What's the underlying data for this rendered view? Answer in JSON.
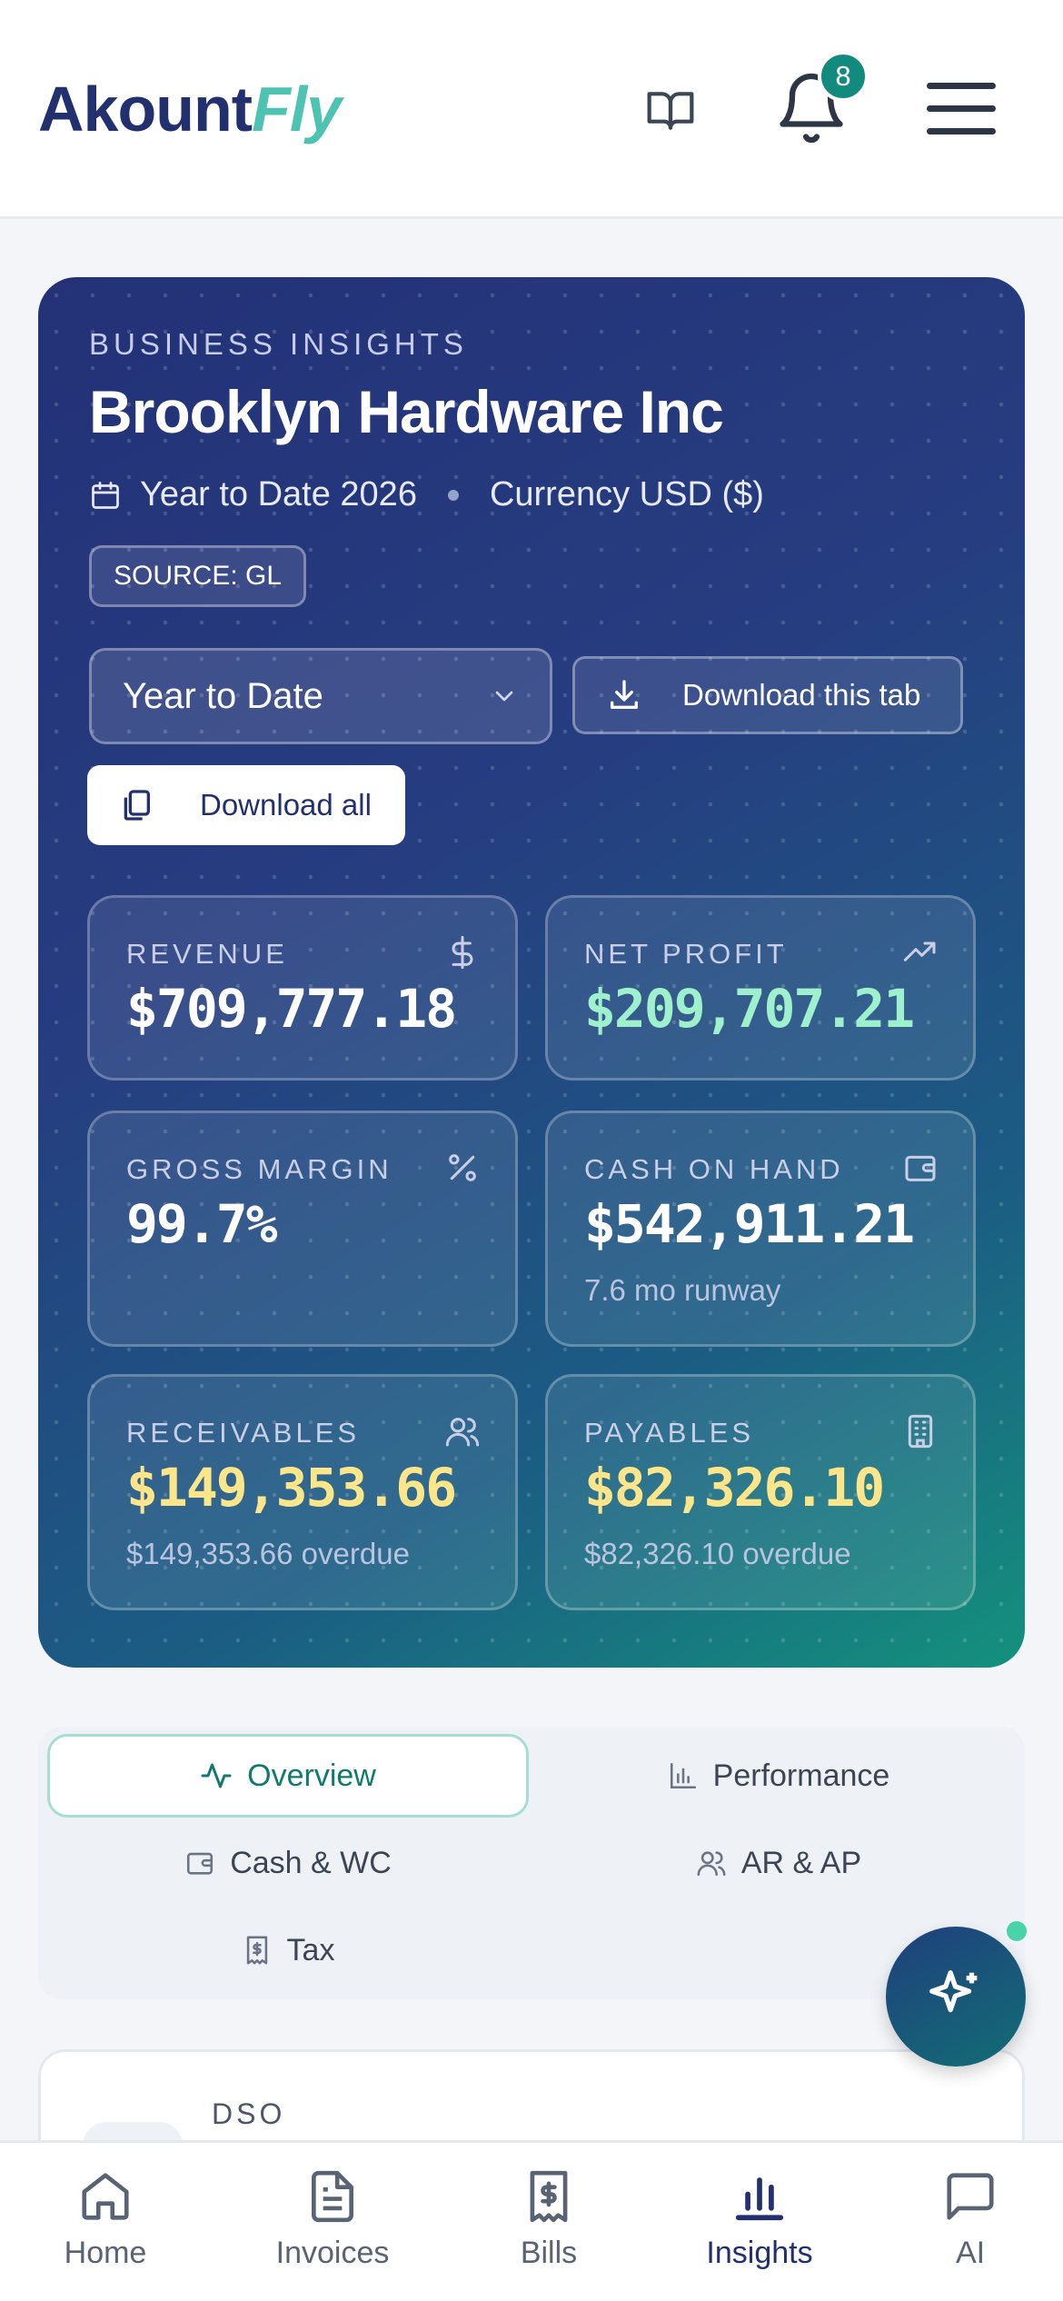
{
  "header": {
    "logo_left": "Akount",
    "logo_right": "Fly",
    "notification_count": "8"
  },
  "hero": {
    "eyebrow": "BUSINESS INSIGHTS",
    "company": "Brooklyn Hardware Inc",
    "period": "Year to Date 2026",
    "currency": "Currency USD ($)",
    "source": "SOURCE: GL",
    "period_select": "Year to Date",
    "download_tab": "Download this tab",
    "download_all": "Download all"
  },
  "metrics": {
    "revenue": {
      "label": "REVENUE",
      "value": "$709,777.18"
    },
    "net_profit": {
      "label": "NET PROFIT",
      "value": "$209,707.21"
    },
    "gross_margin": {
      "label": "GROSS MARGIN",
      "value": "99.7%"
    },
    "cash": {
      "label": "CASH ON HAND",
      "value": "$542,911.21",
      "sub": "7.6 mo runway"
    },
    "receivables": {
      "label": "RECEIVABLES",
      "value": "$149,353.66",
      "sub": "$149,353.66 overdue"
    },
    "payables": {
      "label": "PAYABLES",
      "value": "$82,326.10",
      "sub": "$82,326.10 overdue"
    }
  },
  "tabs": [
    "Overview",
    "Performance",
    "Cash & WC",
    "AR & AP",
    "Tax"
  ],
  "dso": {
    "label": "DSO"
  },
  "nav": [
    "Home",
    "Invoices",
    "Bills",
    "Insights",
    "AI"
  ],
  "colors": {
    "brand_navy": "#22306f",
    "brand_teal": "#4ec3b2",
    "accent_green": "#9ff0cc",
    "accent_yellow": "#fde68a",
    "badge": "#138a7e"
  }
}
